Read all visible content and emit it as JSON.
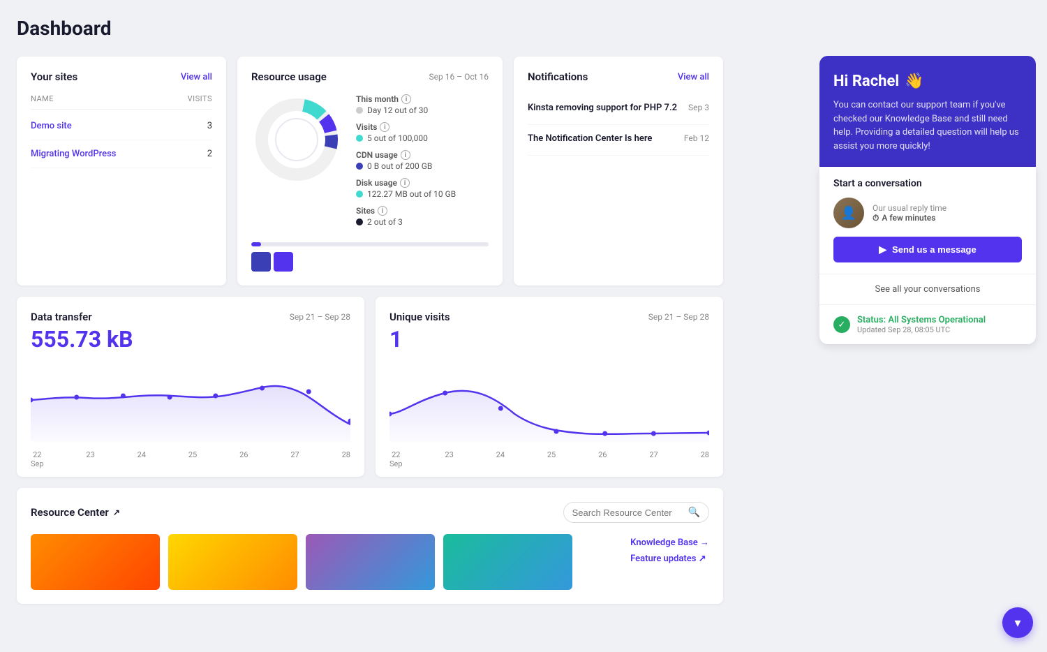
{
  "page": {
    "title": "Dashboard"
  },
  "sites_card": {
    "title": "Your sites",
    "view_all": "View all",
    "table_headers": {
      "name": "NAME",
      "visits": "VISITS"
    },
    "sites": [
      {
        "name": "Demo site",
        "visits": "3"
      },
      {
        "name": "Migrating WordPress",
        "visits": "2"
      }
    ]
  },
  "resource_card": {
    "title": "Resource usage",
    "date_range": "Sep 16 – Oct 16",
    "stats": {
      "this_month": {
        "label": "This month",
        "value": "Day 12 out of 30"
      },
      "visits": {
        "label": "Visits",
        "value": "5 out of 100,000"
      },
      "cdn": {
        "label": "CDN usage",
        "value": "0 B out of 200 GB"
      },
      "disk": {
        "label": "Disk usage",
        "value": "122.27 MB out of 10 GB"
      },
      "sites": {
        "label": "Sites",
        "value": "2 out of 3"
      }
    }
  },
  "notifications_card": {
    "title": "Notifications",
    "view_all": "View all",
    "items": [
      {
        "title": "Kinsta removing support for PHP 7.2",
        "date": "Sep 3"
      },
      {
        "title": "The Notification Center Is here",
        "date": "Feb 12"
      }
    ]
  },
  "data_transfer": {
    "title": "Data transfer",
    "date_range": "Sep 21 – Sep 28",
    "value": "555.73 kB",
    "labels": [
      "22",
      "23",
      "24",
      "25",
      "26",
      "27",
      "28"
    ],
    "sub_labels": [
      "Sep",
      "",
      "",
      "",
      "",
      "",
      ""
    ]
  },
  "unique_visits": {
    "title": "Unique visits",
    "date_range": "Sep 21 – Sep 28",
    "value": "1",
    "labels": [
      "22",
      "23",
      "24",
      "25",
      "26",
      "27",
      "28"
    ],
    "sub_labels": [
      "Sep",
      "",
      "",
      "",
      "",
      "",
      ""
    ]
  },
  "resource_center": {
    "title": "Resource Center",
    "search_placeholder": "Search Resource Center",
    "links": [
      {
        "label": "Knowledge Base →"
      },
      {
        "label": "Feature updates ↗"
      }
    ]
  },
  "support": {
    "greeting": "Hi Rachel",
    "wave_emoji": "👋",
    "description": "You can contact our support team if you've checked our Knowledge Base and still need help. Providing a detailed question will help us assist you more quickly!",
    "conversation_title": "Start a conversation",
    "reply_time_label": "Our usual reply time",
    "reply_time_value": "A few minutes",
    "send_button": "Send us a message",
    "see_all": "See all your conversations",
    "status_text": "Status: All Systems Operational",
    "status_updated": "Updated Sep 28, 08:05 UTC"
  },
  "colors": {
    "accent": "#5333ed",
    "teal": "#40d9d0",
    "dark_blue": "#3b3fb6",
    "support_bg": "#3d30c4"
  }
}
